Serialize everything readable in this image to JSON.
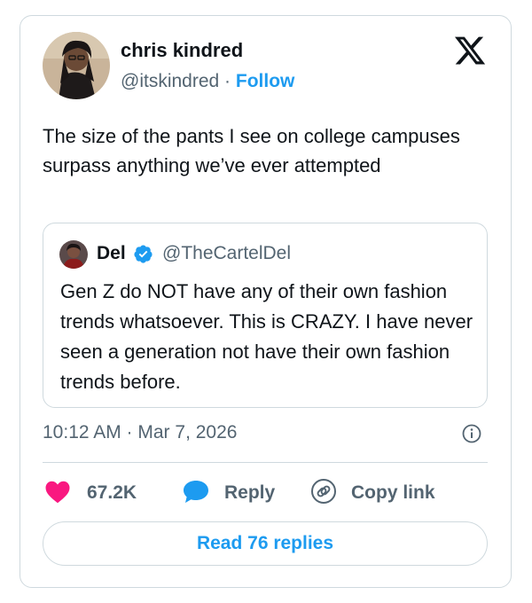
{
  "author": {
    "name": "chris kindred",
    "handle": "@itskindred",
    "separator": "·",
    "follow_label": "Follow"
  },
  "tweet": {
    "text": "The size of the pants I see on college campuses surpass anything we’ve ever attempted"
  },
  "quoted": {
    "name": "Del",
    "handle": "@TheCartelDel",
    "text": "Gen Z do NOT have any of their own fashion trends whatsoever. This is CRAZY. I have never seen a generation not have their own fashion trends before."
  },
  "timestamp": "10:12 AM · Mar 7, 2026",
  "actions": {
    "likes": "67.2K",
    "reply_label": "Reply",
    "copy_label": "Copy link"
  },
  "read_replies_label": "Read 76 replies",
  "icons": {
    "like": "heart-icon",
    "reply": "speech-bubble-icon",
    "copy": "link-icon",
    "info": "info-icon",
    "brand": "x-logo-icon",
    "verified": "verified-badge-icon"
  },
  "colors": {
    "accent": "#1d9bf0",
    "like": "#f91880",
    "secondary_text": "#536471",
    "border": "#cfd9de"
  }
}
